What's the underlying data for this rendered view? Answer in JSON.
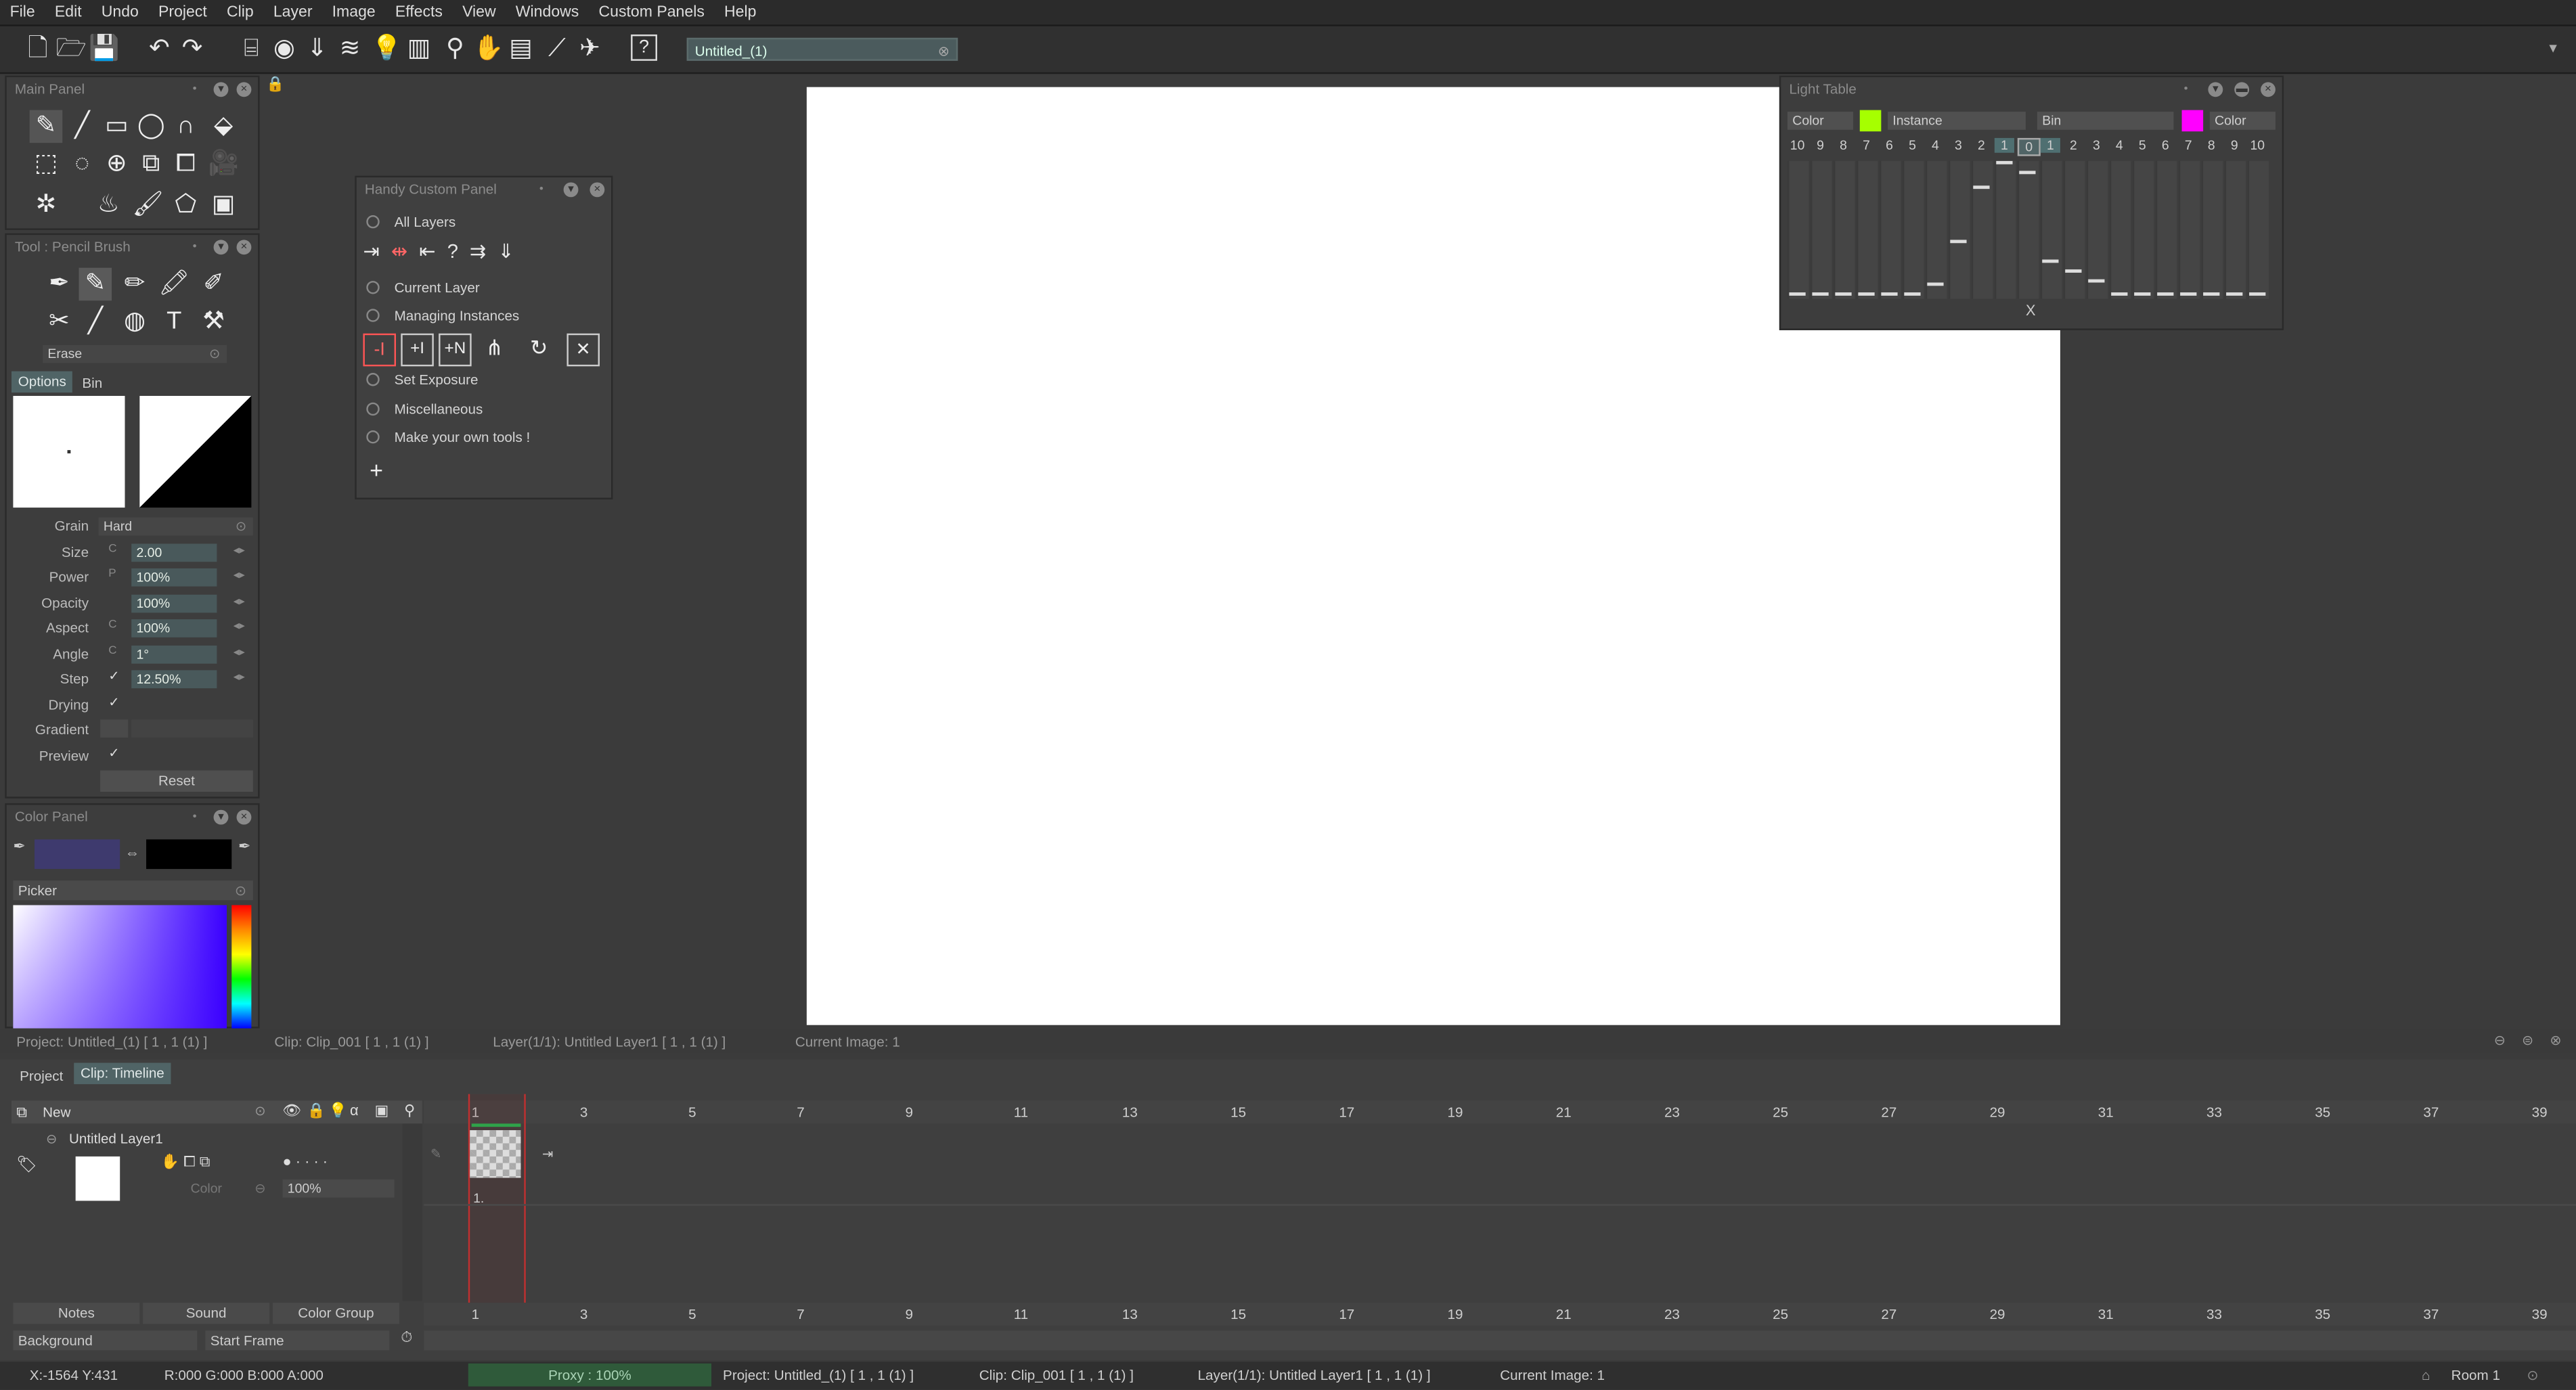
{
  "menubar": {
    "items": [
      "File",
      "Edit",
      "Undo",
      "Project",
      "Clip",
      "Layer",
      "Image",
      "Effects",
      "View",
      "Windows",
      "Custom Panels",
      "Help"
    ]
  },
  "toolbar": {
    "project_title": "Untitled_(1)"
  },
  "main_panel": {
    "title": "Main Panel"
  },
  "tool_panel": {
    "title": "Tool : Pencil Brush",
    "mode": "Erase",
    "tabs": [
      "Options",
      "Bin"
    ],
    "grain_label": "Grain",
    "grain_value": "Hard",
    "size_label": "Size",
    "size_value": "2.00",
    "power_label": "Power",
    "power_value": "100%",
    "opacity_label": "Opacity",
    "opacity_value": "100%",
    "aspect_label": "Aspect",
    "aspect_value": "100%",
    "angle_label": "Angle",
    "angle_value": "1°",
    "step_label": "Step",
    "step_value": "12.50%",
    "drying_label": "Drying",
    "gradient_label": "Gradient",
    "preview_label": "Preview",
    "reset_label": "Reset",
    "size_mod": "C",
    "power_mod": "P",
    "aspect_mod": "C",
    "angle_mod": "C"
  },
  "color_panel": {
    "title": "Color Panel",
    "picker_label": "Picker",
    "primary_color": "#3e3a6e",
    "secondary_color": "#000000"
  },
  "handy_panel": {
    "title": "Handy Custom Panel",
    "sections": [
      "All Layers",
      "Current Layer",
      "Managing Instances",
      "Set Exposure",
      "Miscellaneous",
      "Make your own tools !"
    ],
    "add_label": "+"
  },
  "light_table": {
    "title": "Light Table",
    "dropdowns": [
      "Color",
      "Instance",
      "Bin",
      "Color"
    ],
    "numbers": [
      "10",
      "9",
      "8",
      "7",
      "6",
      "5",
      "4",
      "3",
      "2",
      "1",
      "0",
      "1",
      "2",
      "3",
      "4",
      "5",
      "6",
      "7",
      "8",
      "9",
      "10"
    ],
    "center_mark": "X",
    "swatch_green": "#a6ff00",
    "swatch_magenta": "#ff00ff"
  },
  "status_top": {
    "project": "Project: Untitled_(1) [ 1 , 1  (1) ]",
    "clip": "Clip: Clip_001 [ 1 , 1  (1) ]",
    "layer": "Layer(1/1): Untitled Layer1 [ 1 , 1  (1) ]",
    "image": "Current Image: 1"
  },
  "timeline": {
    "tabs": [
      "Project",
      "Clip: Timeline"
    ],
    "new_label": "New",
    "layer_name": "Untitled Layer1",
    "color_label": "Color",
    "opacity": "100%",
    "frame_marks": [
      "1",
      "3",
      "5",
      "7",
      "9",
      "11",
      "13",
      "15",
      "17",
      "19",
      "21",
      "23",
      "25",
      "27",
      "29",
      "31",
      "33",
      "35",
      "37",
      "39"
    ],
    "cell_label": "1.",
    "bottom_buttons": [
      "Notes",
      "Sound",
      "Color Group"
    ],
    "background_label": "Background",
    "start_frame_label": "Start Frame"
  },
  "bottom_bar": {
    "coords": "X:-1564  Y:431",
    "rgba": "R:000 G:000 B:000 A:000",
    "proxy": "Proxy : 100%",
    "project": "Project: Untitled_(1) [ 1 , 1  (1) ]",
    "clip": "Clip: Clip_001 [ 1 , 1  (1) ]",
    "layer": "Layer(1/1): Untitled Layer1 [ 1 , 1  (1) ]",
    "image": "Current Image: 1",
    "room": "Room 1"
  }
}
